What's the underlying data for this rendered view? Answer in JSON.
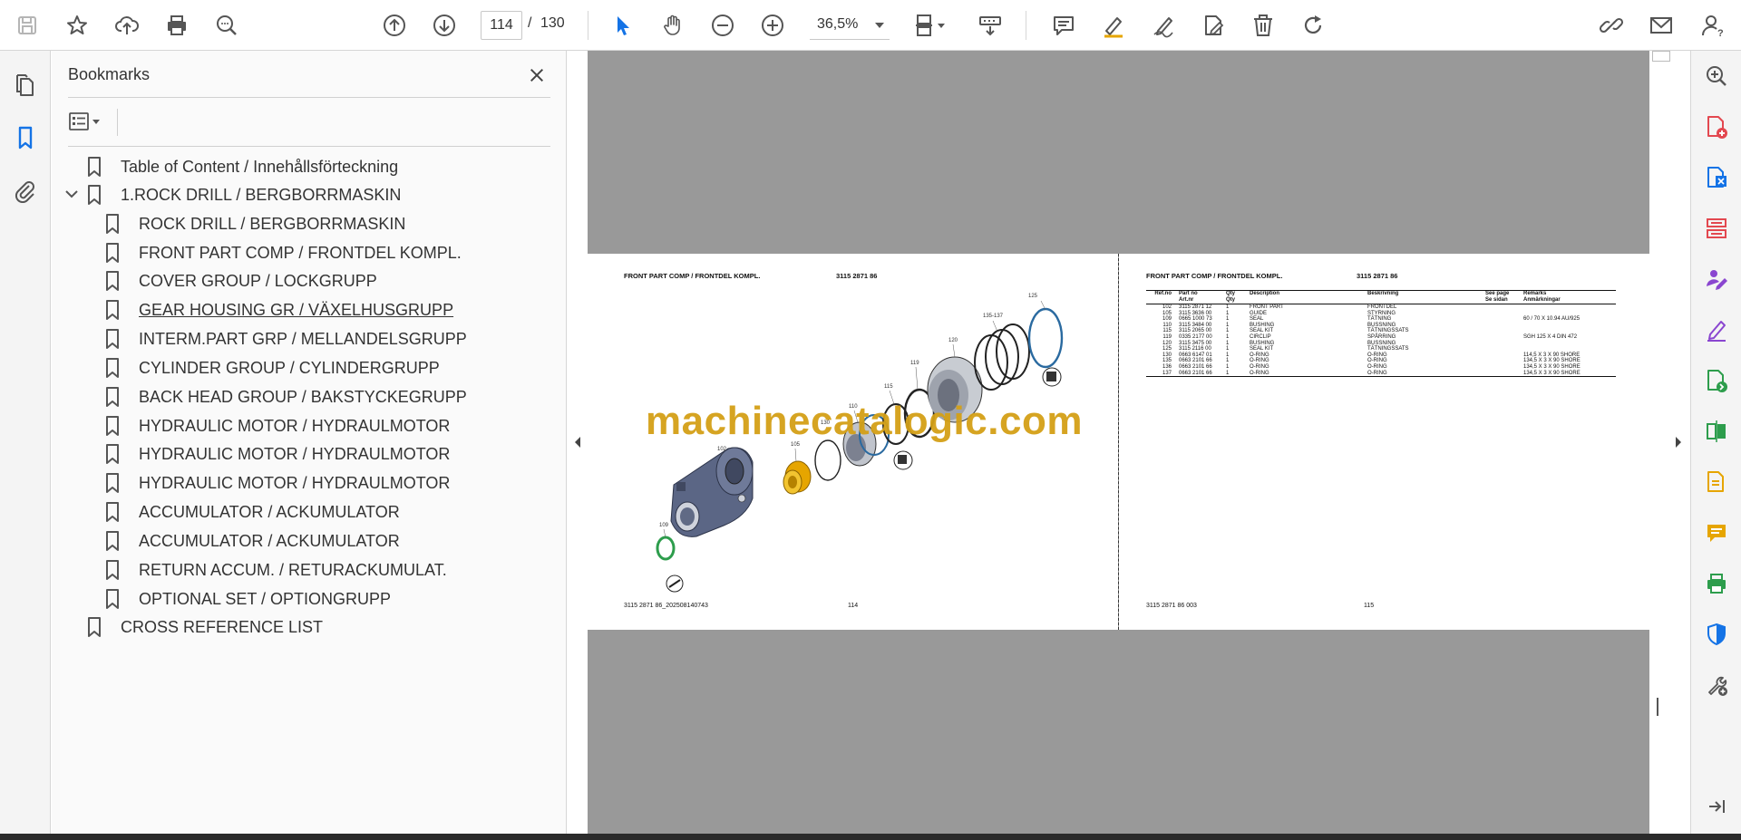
{
  "toolbar": {
    "page_current": "114",
    "page_separator": "/",
    "page_total": "130",
    "zoom": "36,5%"
  },
  "bookmarks": {
    "title": "Bookmarks",
    "items": [
      {
        "label": "Table of Content / Innehållsförteckning",
        "level": 0
      },
      {
        "label": "1.ROCK DRILL / BERGBORRMASKIN",
        "level": 0,
        "expanded": true
      },
      {
        "label": "ROCK DRILL / BERGBORRMASKIN",
        "level": 1
      },
      {
        "label": "FRONT PART COMP / FRONTDEL KOMPL.",
        "level": 1
      },
      {
        "label": "COVER GROUP / LOCKGRUPP",
        "level": 1
      },
      {
        "label": "GEAR HOUSING GR / VÄXELHUSGRUPP",
        "level": 1,
        "hovered": true
      },
      {
        "label": "INTERM.PART GRP / MELLANDELSGRUPP",
        "level": 1
      },
      {
        "label": "CYLINDER GROUP / CYLINDERGRUPP",
        "level": 1
      },
      {
        "label": "BACK HEAD GROUP / BAKSTYCKEGRUPP",
        "level": 1
      },
      {
        "label": "HYDRAULIC MOTOR / HYDRAULMOTOR",
        "level": 1
      },
      {
        "label": "HYDRAULIC MOTOR / HYDRAULMOTOR",
        "level": 1
      },
      {
        "label": "HYDRAULIC MOTOR / HYDRAULMOTOR",
        "level": 1
      },
      {
        "label": "ACCUMULATOR / ACKUMULATOR",
        "level": 1
      },
      {
        "label": "ACCUMULATOR / ACKUMULATOR",
        "level": 1
      },
      {
        "label": "RETURN ACCUM. / RETURACKUMULAT.",
        "level": 1
      },
      {
        "label": "OPTIONAL SET / OPTIONGRUPP",
        "level": 1
      },
      {
        "label": "CROSS REFERENCE LIST",
        "level": 0
      }
    ]
  },
  "left_page": {
    "title": "FRONT PART COMP / FRONTDEL KOMPL.",
    "part_number": "3115 2871 86",
    "footer_left": "3115 2871 86_202508140743",
    "footer_page": "114",
    "callouts": [
      "125",
      "135-137",
      "120",
      "119",
      "115",
      "110",
      "130",
      "105",
      "102",
      "109"
    ]
  },
  "right_page": {
    "title": "FRONT PART COMP / FRONTDEL KOMPL.",
    "part_number": "3115 2871 86",
    "footer_left": "3115 2871 86 003",
    "footer_page": "115",
    "headers": {
      "ref": [
        "Ref.no",
        ""
      ],
      "part": [
        "Part no",
        "Art.nr"
      ],
      "qty": [
        "Qty",
        "Qty"
      ],
      "desc": [
        "Description",
        ""
      ],
      "besk": [
        "Beskrivning",
        ""
      ],
      "see": [
        "See page",
        "Se sidan"
      ],
      "rem": [
        "Remarks",
        "Anmärkningar"
      ]
    },
    "rows": [
      {
        "ref": "102",
        "part": "3115 2871 12",
        "qty": "1",
        "desc": "FRONT PART",
        "besk": "FRONTDEL",
        "see": "",
        "rem": ""
      },
      {
        "ref": "105",
        "part": "3115 3636 00",
        "qty": "1",
        "desc": "GUIDE",
        "besk": "STYRNING",
        "see": "",
        "rem": ""
      },
      {
        "ref": "109",
        "part": "0665 1000 73",
        "qty": "1",
        "desc": "SEAL",
        "besk": "TÄTNING",
        "see": "",
        "rem": "60 / 70 X 10.94 AU/925"
      },
      {
        "ref": "110",
        "part": "3115 3484 00",
        "qty": "1",
        "desc": "BUSHING",
        "besk": "BUSSNING",
        "see": "",
        "rem": ""
      },
      {
        "ref": "115",
        "part": "3115 2065 00",
        "qty": "1",
        "desc": "SEAL KIT",
        "besk": "TÄTNINGSSATS",
        "see": "",
        "rem": ""
      },
      {
        "ref": "119",
        "part": "0335 2177 00",
        "qty": "1",
        "desc": "CIRCLIP",
        "besk": "SPÅRRING",
        "see": "",
        "rem": "SGH 125 X 4 DIN 472"
      },
      {
        "ref": "120",
        "part": "3115 3475 00",
        "qty": "1",
        "desc": "BUSHING",
        "besk": "BUSSNING",
        "see": "",
        "rem": ""
      },
      {
        "ref": "125",
        "part": "3115 2116 00",
        "qty": "1",
        "desc": "SEAL KIT",
        "besk": "TÄTNINGSSATS",
        "see": "",
        "rem": ""
      },
      {
        "ref": "130",
        "part": "0663 6147 01",
        "qty": "1",
        "desc": "O-RING",
        "besk": "O-RING",
        "see": "",
        "rem": "114,5 X 3 X 90 SHORE"
      },
      {
        "ref": "135",
        "part": "0663 2101 66",
        "qty": "1",
        "desc": "O-RING",
        "besk": "O-RING",
        "see": "",
        "rem": "134,5 X 3 X 90 SHORE"
      },
      {
        "ref": "136",
        "part": "0663 2101 66",
        "qty": "1",
        "desc": "O-RING",
        "besk": "O-RING",
        "see": "",
        "rem": "134,5 X 3 X 90 SHORE"
      },
      {
        "ref": "137",
        "part": "0663 2101 66",
        "qty": "1",
        "desc": "O-RING",
        "besk": "O-RING",
        "see": "",
        "rem": "134,5 X 3 X 90 SHORE"
      }
    ]
  },
  "watermark": "machinecatalogic.com",
  "colors": {
    "accent_blue": "#1473e6",
    "doc_background": "#999999",
    "watermark": "#d4a017",
    "purple": "#8a46d0",
    "red": "#e34850",
    "green": "#2d9d4c",
    "yellow": "#e6a500"
  }
}
